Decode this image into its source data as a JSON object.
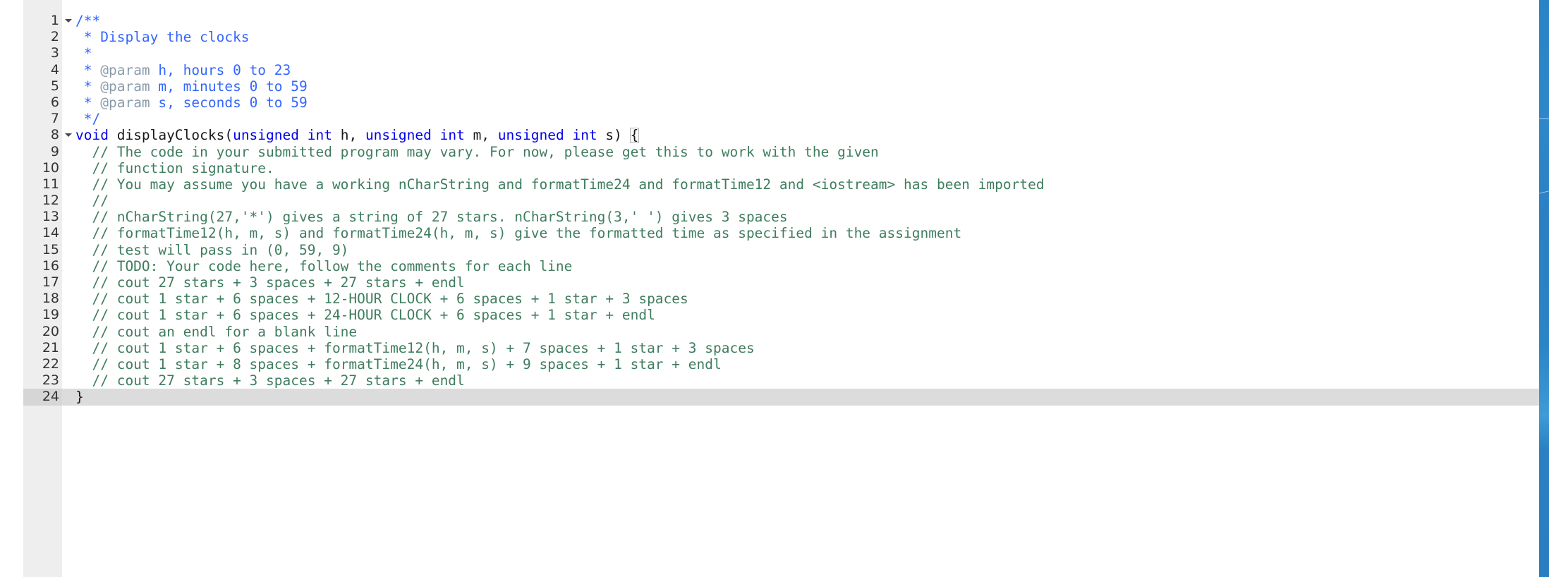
{
  "editor": {
    "name": "code-editor",
    "language": "cpp",
    "font_size_px": 19,
    "active_line": 24,
    "gutter_bg": "#eeeeee",
    "active_line_bg": "#dcdcdc",
    "colors": {
      "doc_comment": "#3366ff",
      "doc_tag": "#8b9cab",
      "line_comment": "#3f7d5e",
      "keyword": "#0000ee",
      "plain_text": "#181818",
      "background": "#ffffff",
      "desktop": "#2a83c6"
    },
    "fold_markers": [
      1,
      8
    ]
  },
  "lines": [
    {
      "n": "1",
      "fold": true,
      "indent": 0,
      "tokens": [
        {
          "c": "doc",
          "t": "/**"
        }
      ]
    },
    {
      "n": "2",
      "fold": false,
      "indent": 0,
      "tokens": [
        {
          "c": "doc",
          "t": " * Display the clocks"
        }
      ]
    },
    {
      "n": "3",
      "fold": false,
      "indent": 0,
      "tokens": [
        {
          "c": "doc",
          "t": " *"
        }
      ]
    },
    {
      "n": "4",
      "fold": false,
      "indent": 0,
      "tokens": [
        {
          "c": "doc",
          "t": " * "
        },
        {
          "c": "tag",
          "t": "@param"
        },
        {
          "c": "doc",
          "t": " h, hours 0 to 23"
        }
      ]
    },
    {
      "n": "5",
      "fold": false,
      "indent": 0,
      "tokens": [
        {
          "c": "doc",
          "t": " * "
        },
        {
          "c": "tag",
          "t": "@param"
        },
        {
          "c": "doc",
          "t": " m, minutes 0 to 59"
        }
      ]
    },
    {
      "n": "6",
      "fold": false,
      "indent": 0,
      "tokens": [
        {
          "c": "doc",
          "t": " * "
        },
        {
          "c": "tag",
          "t": "@param"
        },
        {
          "c": "doc",
          "t": " s, seconds 0 to 59"
        }
      ]
    },
    {
      "n": "7",
      "fold": false,
      "indent": 0,
      "tokens": [
        {
          "c": "doc",
          "t": " */"
        }
      ]
    },
    {
      "n": "8",
      "fold": true,
      "indent": 0,
      "tokens": [
        {
          "c": "kw",
          "t": "void"
        },
        {
          "c": "plain",
          "t": " displayClocks("
        },
        {
          "c": "kw",
          "t": "unsigned int"
        },
        {
          "c": "plain",
          "t": " h, "
        },
        {
          "c": "kw",
          "t": "unsigned int"
        },
        {
          "c": "plain",
          "t": " m, "
        },
        {
          "c": "kw",
          "t": "unsigned int"
        },
        {
          "c": "plain",
          "t": " s) "
        },
        {
          "c": "brace",
          "t": "{"
        }
      ]
    },
    {
      "n": "9",
      "fold": false,
      "indent": 1,
      "tokens": [
        {
          "c": "cmt",
          "t": "// The code in your submitted program may vary. For now, please get this to work with the given"
        }
      ]
    },
    {
      "n": "10",
      "fold": false,
      "indent": 1,
      "tokens": [
        {
          "c": "cmt",
          "t": "// function signature."
        }
      ]
    },
    {
      "n": "11",
      "fold": false,
      "indent": 1,
      "tokens": [
        {
          "c": "cmt",
          "t": "// You may assume you have a working nCharString and formatTime24 and formatTime12 and <iostream> has been imported"
        }
      ]
    },
    {
      "n": "12",
      "fold": false,
      "indent": 1,
      "tokens": [
        {
          "c": "cmt",
          "t": "//"
        }
      ]
    },
    {
      "n": "13",
      "fold": false,
      "indent": 1,
      "tokens": [
        {
          "c": "cmt",
          "t": "// nCharString(27,'*') gives a string of 27 stars. nCharString(3,' ') gives 3 spaces"
        }
      ]
    },
    {
      "n": "14",
      "fold": false,
      "indent": 1,
      "tokens": [
        {
          "c": "cmt",
          "t": "// formatTime12(h, m, s) and formatTime24(h, m, s) give the formatted time as specified in the assignment"
        }
      ]
    },
    {
      "n": "15",
      "fold": false,
      "indent": 1,
      "tokens": [
        {
          "c": "cmt",
          "t": "// test will pass in (0, 59, 9)"
        }
      ]
    },
    {
      "n": "16",
      "fold": false,
      "indent": 1,
      "tokens": [
        {
          "c": "cmt",
          "t": "// TODO: Your code here, follow the comments for each line"
        }
      ]
    },
    {
      "n": "17",
      "fold": false,
      "indent": 1,
      "tokens": [
        {
          "c": "cmt",
          "t": "// cout 27 stars + 3 spaces + 27 stars + endl"
        }
      ]
    },
    {
      "n": "18",
      "fold": false,
      "indent": 1,
      "tokens": [
        {
          "c": "cmt",
          "t": "// cout 1 star + 6 spaces + 12-HOUR CLOCK + 6 spaces + 1 star + 3 spaces"
        }
      ]
    },
    {
      "n": "19",
      "fold": false,
      "indent": 1,
      "tokens": [
        {
          "c": "cmt",
          "t": "// cout 1 star + 6 spaces + 24-HOUR CLOCK + 6 spaces + 1 star + endl"
        }
      ]
    },
    {
      "n": "20",
      "fold": false,
      "indent": 1,
      "tokens": [
        {
          "c": "cmt",
          "t": "// cout an endl for a blank line"
        }
      ]
    },
    {
      "n": "21",
      "fold": false,
      "indent": 1,
      "tokens": [
        {
          "c": "cmt",
          "t": "// cout 1 star + 6 spaces + formatTime12(h, m, s) + 7 spaces + 1 star + 3 spaces"
        }
      ]
    },
    {
      "n": "22",
      "fold": false,
      "indent": 1,
      "tokens": [
        {
          "c": "cmt",
          "t": "// cout 1 star + 8 spaces + formatTime24(h, m, s) + 9 spaces + 1 star + endl"
        }
      ]
    },
    {
      "n": "23",
      "fold": false,
      "indent": 1,
      "tokens": [
        {
          "c": "cmt",
          "t": "// cout 27 stars + 3 spaces + 27 stars + endl"
        }
      ]
    },
    {
      "n": "24",
      "fold": false,
      "indent": 0,
      "active": true,
      "tokens": [
        {
          "c": "plain",
          "t": "}"
        }
      ]
    }
  ]
}
